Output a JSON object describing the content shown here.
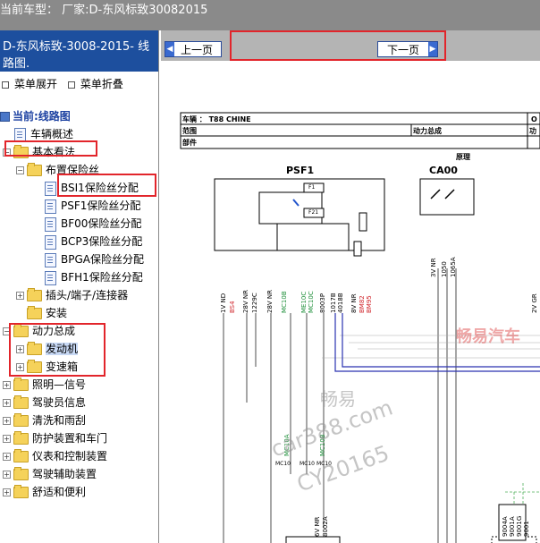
{
  "titlebar": {
    "text": "当前车型： 厂家:D-东风标致30082015"
  },
  "sidebar": {
    "header": "D-东风标致-3008-2015- 线路图.",
    "expand_all": "菜单展开",
    "collapse_all": "菜单折叠",
    "current": "当前:线路图",
    "tree": [
      {
        "label": "车辆概述"
      },
      {
        "label": "基本看法"
      },
      {
        "label": "布置保险丝"
      },
      {
        "label": "BSI1保险丝分配"
      },
      {
        "label": "PSF1保险丝分配"
      },
      {
        "label": "BF00保险丝分配"
      },
      {
        "label": "BCP3保险丝分配"
      },
      {
        "label": "BPGA保险丝分配"
      },
      {
        "label": "BFH1保险丝分配"
      },
      {
        "label": "插头/端子/连接器"
      },
      {
        "label": "安装"
      },
      {
        "label": "动力总成"
      },
      {
        "label": "发动机"
      },
      {
        "label": "变速箱"
      },
      {
        "label": "照明—信号"
      },
      {
        "label": "驾驶员信息"
      },
      {
        "label": "清洗和雨刮"
      },
      {
        "label": "防护装置和车门"
      },
      {
        "label": "仪表和控制装置"
      },
      {
        "label": "驾驶辅助装置"
      },
      {
        "label": "舒适和便利"
      }
    ]
  },
  "nav": {
    "prev": "上一页",
    "next": "下一页"
  },
  "diagram": {
    "vehicle_label": "车辆 ： T88 CHINE",
    "range_label": "范围",
    "powertrain_label": "动力总成",
    "part_label": "部件",
    "principle_label": "原理",
    "col_o": "O",
    "col_func": "功",
    "psf1": "PSF1",
    "ca00": "CA00",
    "f1": "F1",
    "f21": "F21",
    "pins_psf1": [
      "1V ND",
      "BS4",
      "28V NR",
      "1229C",
      "28V NR",
      "MC10B",
      "ME10C",
      "MC10C",
      "8003P",
      "1017B",
      "4018B",
      "8V NR",
      "BM82",
      "BM95"
    ],
    "pins_ca00": [
      "3V NR",
      "1050",
      "1065A"
    ],
    "pin_right": "2V GR",
    "mc10a": "MC10A",
    "mc10b": "MC10B",
    "mc10": "MC10",
    "low_pins": [
      "6V MR",
      "8002A"
    ],
    "right_pins": [
      "9004A",
      "9001A",
      "9001G",
      "9001"
    ],
    "watermark_red": "畅易汽车",
    "watermark_1": "畅易",
    "watermark_2": "car388.com",
    "watermark_3": "CY20165"
  },
  "colors": {
    "titlebar": "#8a8a8a",
    "sidebar_header": "#1d4f9e",
    "highlight_box": "#e2252b",
    "nav_button": "#3a6ad0",
    "blue_wire": "#2a32b0",
    "red_label": "#d0262c",
    "green_label": "#1f8f3a"
  }
}
